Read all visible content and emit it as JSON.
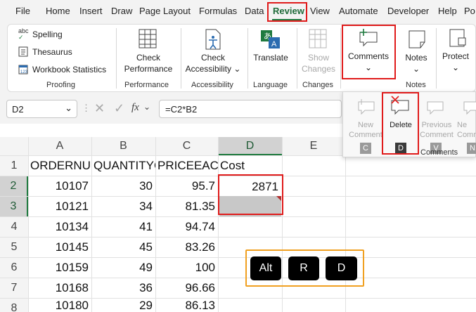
{
  "menu": {
    "tabs": [
      "File",
      "Home",
      "Insert",
      "Draw",
      "Page Layout",
      "Formulas",
      "Data",
      "Review",
      "View",
      "Automate",
      "Developer",
      "Help",
      "Po"
    ],
    "active": "Review"
  },
  "ribbon": {
    "proofing": {
      "spelling": "Spelling",
      "thesaurus": "Thesaurus",
      "workbook_statistics": "Workbook Statistics",
      "label": "Proofing"
    },
    "performance": {
      "check_line1": "Check",
      "check_line2": "Performance",
      "label": "Performance"
    },
    "accessibility": {
      "check_line1": "Check",
      "check_line2": "Accessibility",
      "label": "Accessibility"
    },
    "language": {
      "translate": "Translate",
      "label": "Language"
    },
    "changes": {
      "show_line1": "Show",
      "show_line2": "Changes",
      "label": "Changes"
    },
    "comments": {
      "button": "Comments",
      "label": "Comments"
    },
    "notes": {
      "button": "Notes",
      "label": "Notes"
    },
    "protect": {
      "button": "Protect"
    }
  },
  "formula_bar": {
    "name_box": "D2",
    "formula": "=C2*B2",
    "fx": "fx"
  },
  "comments_menu": {
    "new_line1": "New",
    "new_line2": "Comment",
    "delete": "Delete",
    "previous_line1": "Previous",
    "previous_line2": "Comment",
    "next_line1": "Ne",
    "next_line2": "Comm",
    "group_label": "Comments",
    "keytips": [
      "C",
      "D",
      "V",
      "N"
    ]
  },
  "sheet": {
    "columns": [
      "A",
      "B",
      "C",
      "D",
      "E"
    ],
    "rows": [
      "1",
      "2",
      "3",
      "4",
      "5",
      "6",
      "7",
      "8"
    ],
    "header_row": [
      "ORDERNUMBER",
      "QUANTITYORDERED",
      "PRICEEACH",
      "Cost"
    ],
    "data": [
      [
        "10107",
        "30",
        "95.7",
        "2871"
      ],
      [
        "10121",
        "34",
        "81.35",
        ""
      ],
      [
        "10134",
        "41",
        "94.74",
        ""
      ],
      [
        "10145",
        "45",
        "83.26",
        ""
      ],
      [
        "10159",
        "49",
        "100",
        ""
      ],
      [
        "10168",
        "36",
        "96.66",
        ""
      ],
      [
        "10180",
        "29",
        "86.13",
        ""
      ]
    ]
  },
  "shortcut_keys": [
    "Alt",
    "R",
    "D"
  ],
  "colors": {
    "accent_green": "#1f7a3f",
    "highlight_red": "#e01b1b",
    "highlight_orange": "#f0a020"
  }
}
